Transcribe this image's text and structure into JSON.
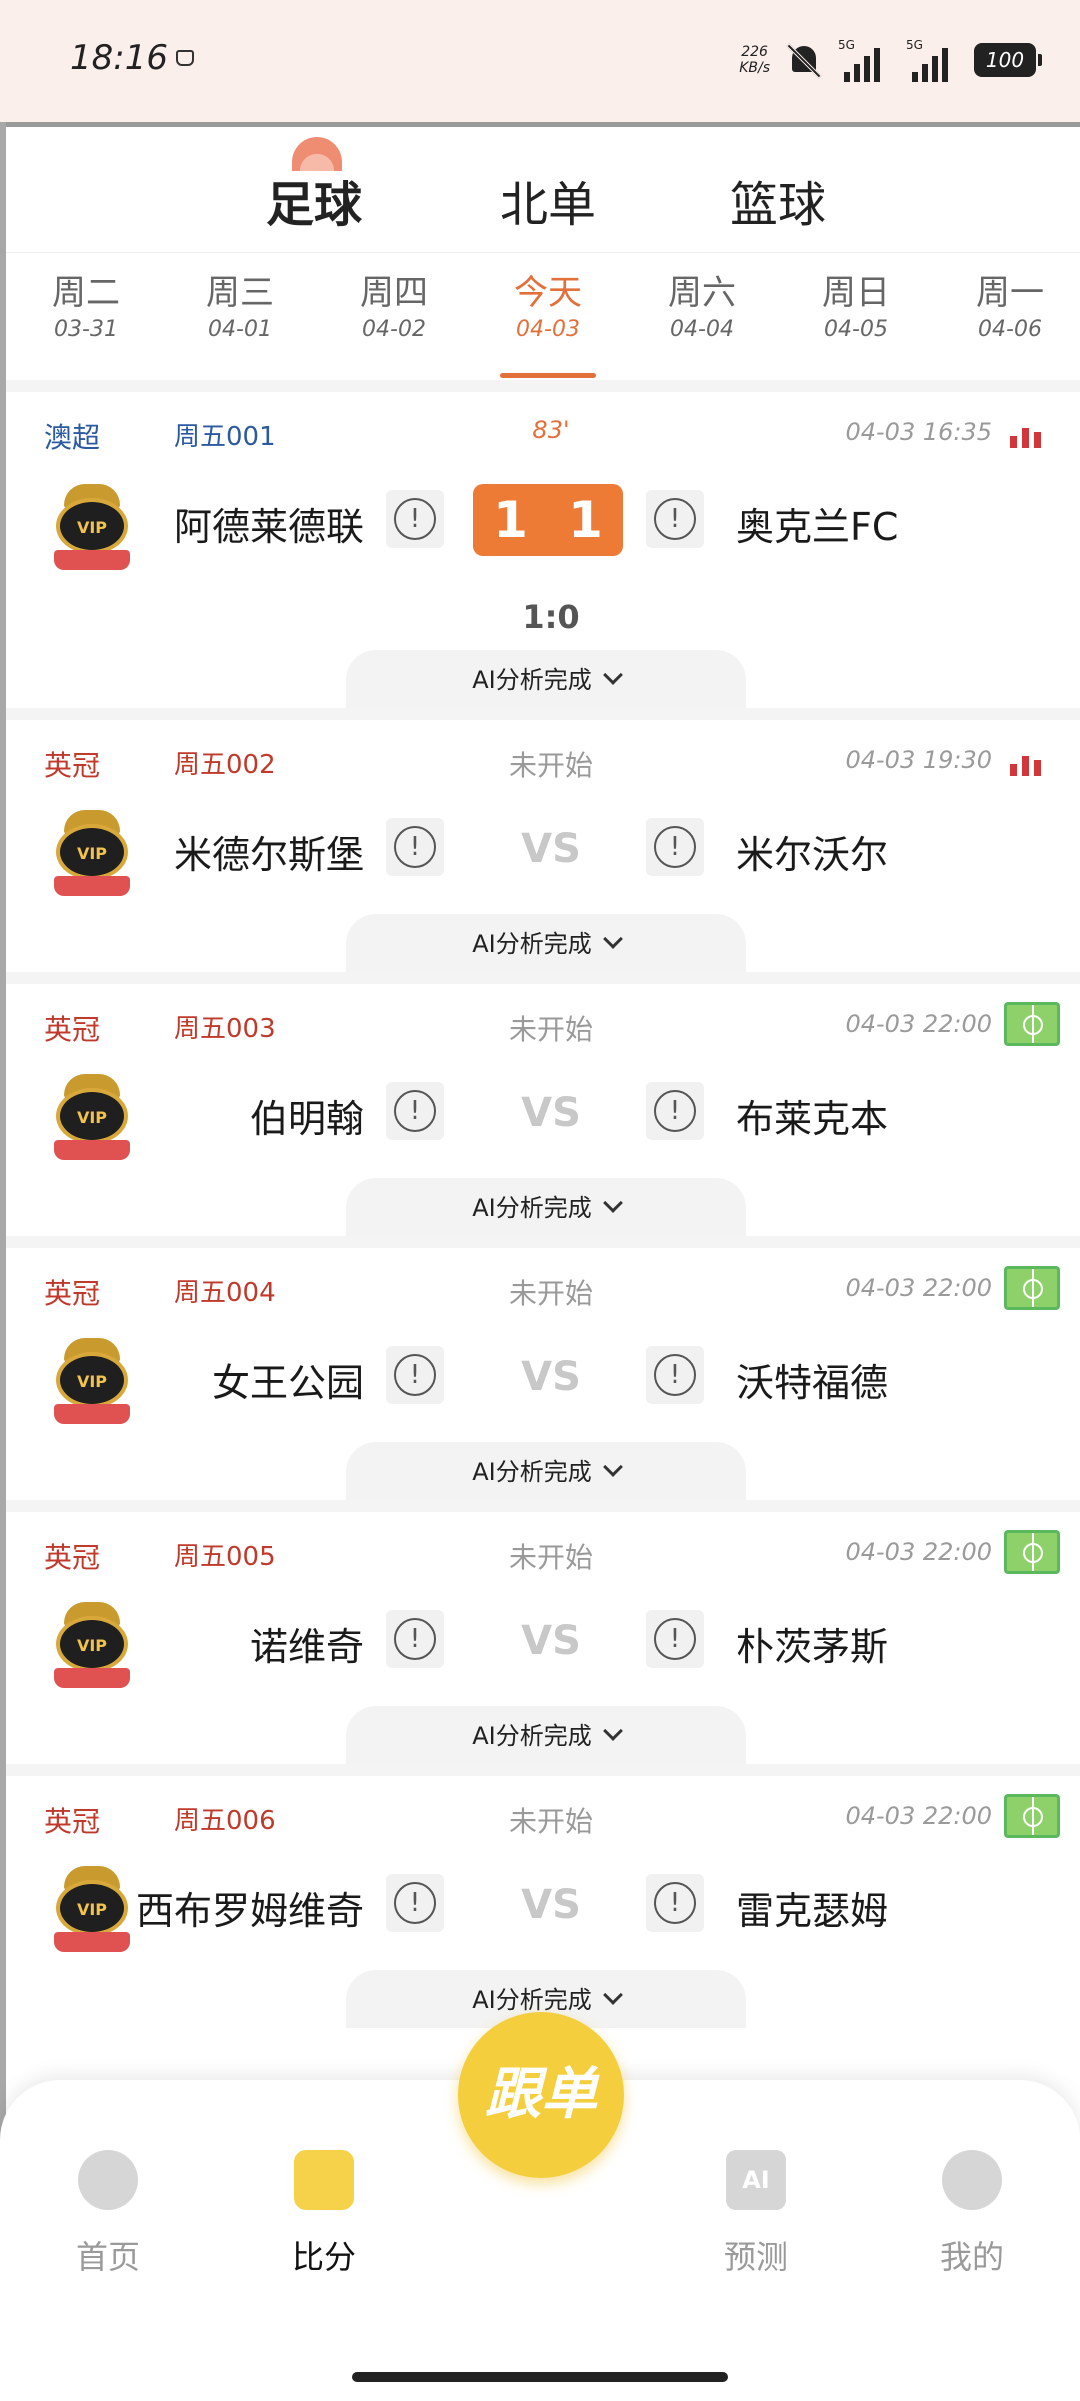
{
  "status_bar": {
    "time": "18:16",
    "net_speed_value": "226",
    "net_speed_unit": "KB/s",
    "sim1": "5G",
    "sim2": "5G",
    "battery": "100"
  },
  "sport_tabs": [
    {
      "label": "足球",
      "active": true
    },
    {
      "label": "北单",
      "active": false
    },
    {
      "label": "篮球",
      "active": false
    }
  ],
  "day_tabs": [
    {
      "day": "周二",
      "date": "03-31"
    },
    {
      "day": "周三",
      "date": "04-01"
    },
    {
      "day": "周四",
      "date": "04-02"
    },
    {
      "day": "今天",
      "date": "04-03",
      "active": true
    },
    {
      "day": "周六",
      "date": "04-04"
    },
    {
      "day": "周日",
      "date": "04-05"
    },
    {
      "day": "周一",
      "date": "04-06"
    }
  ],
  "matches": [
    {
      "league": "澳超",
      "code": "周五001",
      "status": "83'",
      "time": "04-03 16:35",
      "home": "阿德莱德联",
      "away": "奥克兰FC",
      "score_home": "1",
      "score_away": "1",
      "half": "1:0",
      "ai": "AI分析完成",
      "icon": "stats-icon"
    },
    {
      "league": "英冠",
      "code": "周五002",
      "status": "未开始",
      "time": "04-03 19:30",
      "home": "米德尔斯堡",
      "away": "米尔沃尔",
      "vs": "VS",
      "ai": "AI分析完成",
      "icon": "stats-icon"
    },
    {
      "league": "英冠",
      "code": "周五003",
      "status": "未开始",
      "time": "04-03 22:00",
      "home": "伯明翰",
      "away": "布莱克本",
      "vs": "VS",
      "ai": "AI分析完成",
      "icon": "field-icon"
    },
    {
      "league": "英冠",
      "code": "周五004",
      "status": "未开始",
      "time": "04-03 22:00",
      "home": "女王公园",
      "away": "沃特福德",
      "vs": "VS",
      "ai": "AI分析完成",
      "icon": "field-icon"
    },
    {
      "league": "英冠",
      "code": "周五005",
      "status": "未开始",
      "time": "04-03 22:00",
      "home": "诺维奇",
      "away": "朴茨茅斯",
      "vs": "VS",
      "ai": "AI分析完成",
      "icon": "field-icon"
    },
    {
      "league": "英冠",
      "code": "周五006",
      "status": "未开始",
      "time": "04-03 22:00",
      "home": "西布罗姆维奇",
      "away": "雷克瑟姆",
      "vs": "VS",
      "ai": "AI分析完成",
      "icon": "field-icon"
    }
  ],
  "vip_badge": "VIP",
  "info_glyph": "!",
  "bottom_nav": [
    {
      "label": "首页"
    },
    {
      "label": "比分",
      "active": true
    },
    {
      "label": "预测",
      "icon_text": "AI"
    },
    {
      "label": "我的"
    }
  ],
  "fab_label": "跟单",
  "colors": {
    "accent": "#e2703a",
    "score_bg": "#ed7a35",
    "fab": "#f4ce3c",
    "league_red": "#c0392b",
    "league_blue": "#2c5aa0"
  }
}
